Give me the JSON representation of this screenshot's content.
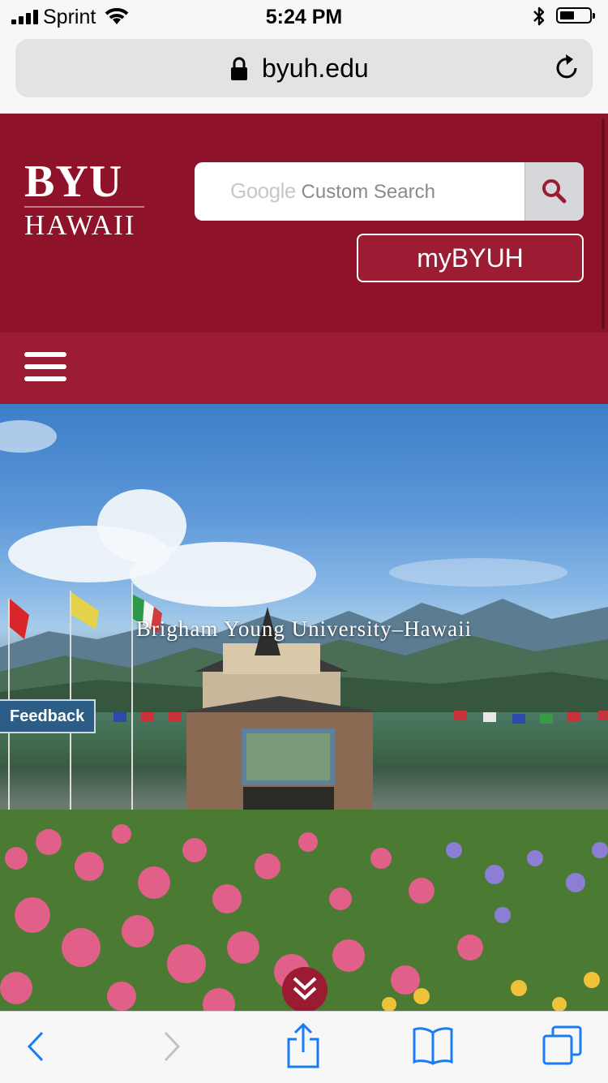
{
  "status_bar": {
    "carrier": "Sprint",
    "time": "5:24 PM",
    "battery_level": 0.5
  },
  "browser": {
    "url": "byuh.edu",
    "lock_icon": "lock-icon",
    "reload_icon": "reload-icon"
  },
  "site": {
    "logo_top": "BYU",
    "logo_bottom": "HAWAII",
    "search": {
      "brand": "Google",
      "placeholder": "Custom Search"
    },
    "mybyuh_label": "myBYUH",
    "hero_title": "Brigham Young University–Hawaii",
    "feedback_label": "Feedback"
  },
  "colors": {
    "brand_crimson": "#8e1229",
    "nav_crimson": "#9a1b32",
    "feedback_blue": "#2b5d86",
    "ios_blue": "#1a7cf5"
  },
  "toolbar": {
    "icons": [
      "back-icon",
      "forward-icon",
      "share-icon",
      "bookmarks-icon",
      "tabs-icon"
    ]
  }
}
